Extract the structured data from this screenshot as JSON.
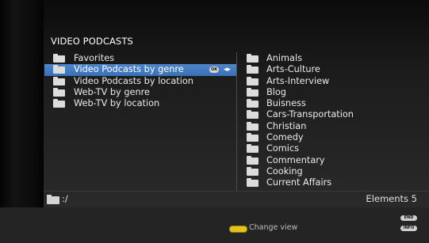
{
  "window": {
    "title": "VIDEO PODCASTS"
  },
  "left_list": {
    "items": [
      {
        "label": "Favorites",
        "selected": false
      },
      {
        "label": "Video Podcasts by genre",
        "selected": true
      },
      {
        "label": "Video Podcasts by location",
        "selected": false
      },
      {
        "label": "Web-TV by genre",
        "selected": false
      },
      {
        "label": "Web-TV by location",
        "selected": false
      }
    ],
    "selected_badge": "OK",
    "selected_arrows": "◂▸"
  },
  "right_list": {
    "items": [
      "Animals",
      "Arts-Culture",
      "Arts-Interview",
      "Blog",
      "Buisness",
      "Cars-Transportation",
      "Christian",
      "Comedy",
      "Comics",
      "Commentary",
      "Cooking",
      "Current Affairs"
    ]
  },
  "status": {
    "path": ":/",
    "elements": "Elements 5"
  },
  "footer": {
    "change_view_label": "Change view",
    "end_key": "END",
    "info_key": "INFO",
    "yellow_color": "#e3c21a"
  }
}
